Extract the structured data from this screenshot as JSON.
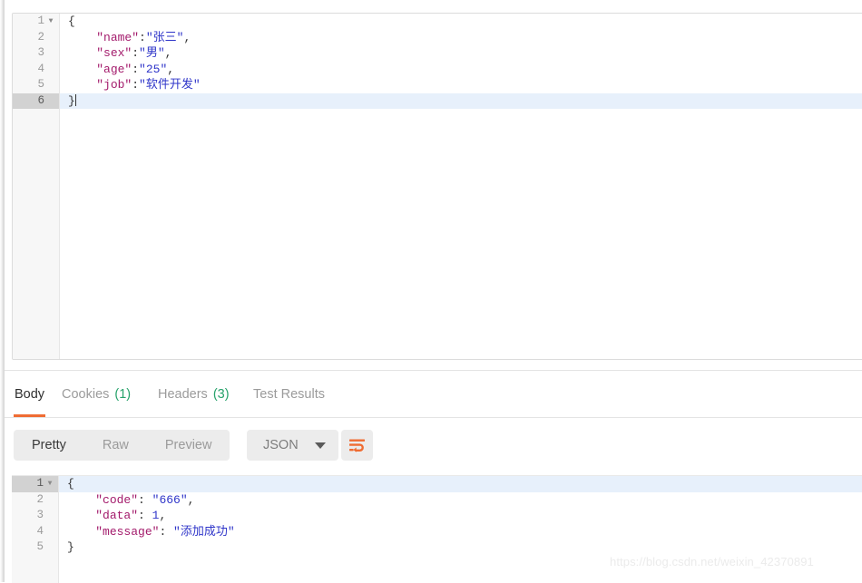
{
  "colors": {
    "accent_orange": "#ef6c33",
    "count_green": "#27a26b",
    "json_key": "#a31a6b",
    "json_string": "#2f35c9",
    "active_line_bg": "#e7f0fb",
    "gutter_bg": "#f7f7f7",
    "toolbar_pill_bg": "#ececec"
  },
  "request_editor": {
    "name": "request-body-json-editor",
    "active_line": 6,
    "lines": [
      {
        "number": "1",
        "foldable": true,
        "tokens": [
          {
            "t": "{",
            "c": "b"
          }
        ],
        "caret": false
      },
      {
        "number": "2",
        "foldable": false,
        "tokens": [
          {
            "t": "    ",
            "c": "p"
          },
          {
            "t": "\"name\"",
            "c": "k"
          },
          {
            "t": ":",
            "c": "p"
          },
          {
            "t": "\"张三\"",
            "c": "s"
          },
          {
            "t": ",",
            "c": "p"
          }
        ],
        "caret": false
      },
      {
        "number": "3",
        "foldable": false,
        "tokens": [
          {
            "t": "    ",
            "c": "p"
          },
          {
            "t": "\"sex\"",
            "c": "k"
          },
          {
            "t": ":",
            "c": "p"
          },
          {
            "t": "\"男\"",
            "c": "s"
          },
          {
            "t": ",",
            "c": "p"
          }
        ],
        "caret": false
      },
      {
        "number": "4",
        "foldable": false,
        "tokens": [
          {
            "t": "    ",
            "c": "p"
          },
          {
            "t": "\"age\"",
            "c": "k"
          },
          {
            "t": ":",
            "c": "p"
          },
          {
            "t": "\"25\"",
            "c": "s"
          },
          {
            "t": ",",
            "c": "p"
          }
        ],
        "caret": false
      },
      {
        "number": "5",
        "foldable": false,
        "tokens": [
          {
            "t": "    ",
            "c": "p"
          },
          {
            "t": "\"job\"",
            "c": "k"
          },
          {
            "t": ":",
            "c": "p"
          },
          {
            "t": "\"软件开发\"",
            "c": "s"
          }
        ],
        "caret": false
      },
      {
        "number": "6",
        "foldable": false,
        "tokens": [
          {
            "t": "}",
            "c": "b"
          }
        ],
        "caret": true
      }
    ]
  },
  "response": {
    "tabs": [
      {
        "label": "Body",
        "count": "",
        "active": true,
        "name": "tab-body"
      },
      {
        "label": "Cookies",
        "count": "(1)",
        "active": false,
        "name": "tab-cookies"
      },
      {
        "label": "Headers",
        "count": "(3)",
        "active": false,
        "name": "tab-headers"
      },
      {
        "label": "Test Results",
        "count": "",
        "active": false,
        "name": "tab-test-results"
      }
    ],
    "toolbar": {
      "format_modes": [
        {
          "label": "Pretty",
          "active": true,
          "name": "format-pretty"
        },
        {
          "label": "Raw",
          "active": false,
          "name": "format-raw"
        },
        {
          "label": "Preview",
          "active": false,
          "name": "format-preview"
        }
      ],
      "type_select_value": "JSON",
      "wrap_icon": "word-wrap-icon"
    },
    "editor": {
      "name": "response-body-json-editor",
      "active_line": 1,
      "lines": [
        {
          "number": "1",
          "foldable": true,
          "tokens": [
            {
              "t": "{",
              "c": "b"
            }
          ],
          "caret": false
        },
        {
          "number": "2",
          "foldable": false,
          "tokens": [
            {
              "t": "    ",
              "c": "p"
            },
            {
              "t": "\"code\"",
              "c": "k"
            },
            {
              "t": ": ",
              "c": "p"
            },
            {
              "t": "\"666\"",
              "c": "s"
            },
            {
              "t": ",",
              "c": "p"
            }
          ],
          "caret": false
        },
        {
          "number": "3",
          "foldable": false,
          "tokens": [
            {
              "t": "    ",
              "c": "p"
            },
            {
              "t": "\"data\"",
              "c": "k"
            },
            {
              "t": ": ",
              "c": "p"
            },
            {
              "t": "1",
              "c": "n"
            },
            {
              "t": ",",
              "c": "p"
            }
          ],
          "caret": false
        },
        {
          "number": "4",
          "foldable": false,
          "tokens": [
            {
              "t": "    ",
              "c": "p"
            },
            {
              "t": "\"message\"",
              "c": "k"
            },
            {
              "t": ": ",
              "c": "p"
            },
            {
              "t": "\"添加成功\"",
              "c": "s"
            }
          ],
          "caret": false
        },
        {
          "number": "5",
          "foldable": false,
          "tokens": [
            {
              "t": "}",
              "c": "b"
            }
          ],
          "caret": false
        }
      ]
    }
  },
  "watermark": "https://blog.csdn.net/weixin_42370891"
}
